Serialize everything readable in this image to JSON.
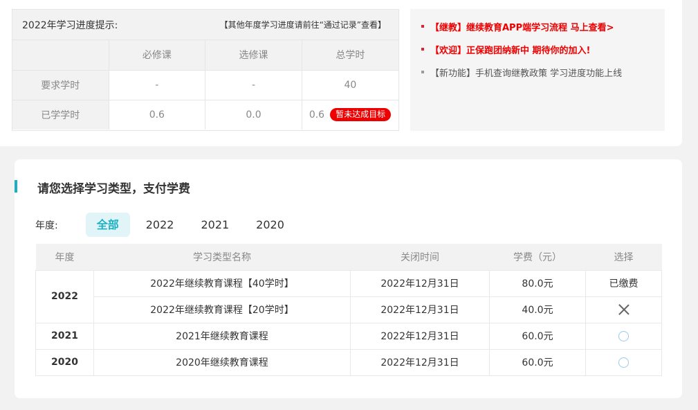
{
  "progress": {
    "title": "2022年学习进度提示:",
    "hint": "【其他年度学习进度请前往“通过记录”查看】",
    "columns": [
      "",
      "必修课",
      "选修课",
      "总学时"
    ],
    "rows": [
      {
        "label": "要求学时",
        "required": "-",
        "elective": "-",
        "total": "40"
      },
      {
        "label": "已学学时",
        "required": "0.6",
        "elective": "0.0",
        "total": "0.6",
        "badge": "暂未达成目标"
      }
    ]
  },
  "news": [
    {
      "text": "【继教】继续教育APP端学习流程 马上查看>",
      "style": "red"
    },
    {
      "text": "【欢迎】正保跑团纳新中 期待你的加入!",
      "style": "red"
    },
    {
      "text": "【新功能】手机查询继教政策 学习进度功能上线",
      "style": "grey"
    }
  ],
  "section": {
    "title": "请您选择学习类型，支付学费"
  },
  "year_filter": {
    "label": "年度:",
    "tabs": [
      "全部",
      "2022",
      "2021",
      "2020"
    ],
    "active": "全部"
  },
  "fee_table": {
    "headers": [
      "年度",
      "学习类型名称",
      "关闭时间",
      "学费（元）",
      "选择"
    ],
    "rows": [
      {
        "year": "2022",
        "name": "2022年继续教育课程【40学时】",
        "close": "2022年12月31日",
        "fee": "80.0元",
        "select": "已缴费",
        "select_type": "paid"
      },
      {
        "year": "",
        "name": "2022年继续教育课程【20学时】",
        "close": "2022年12月31日",
        "fee": "40.0元",
        "select": "",
        "select_type": "x-icon"
      },
      {
        "year": "2021",
        "name": "2021年继续教育课程",
        "close": "2022年12月31日",
        "fee": "60.0元",
        "select": "",
        "select_type": "radio"
      },
      {
        "year": "2020",
        "name": "2020年继续教育课程",
        "close": "2022年12月31日",
        "fee": "60.0元",
        "select": "",
        "select_type": "radio"
      }
    ]
  },
  "colors": {
    "accent": "#1ab0c4",
    "alert": "#ee0000"
  }
}
